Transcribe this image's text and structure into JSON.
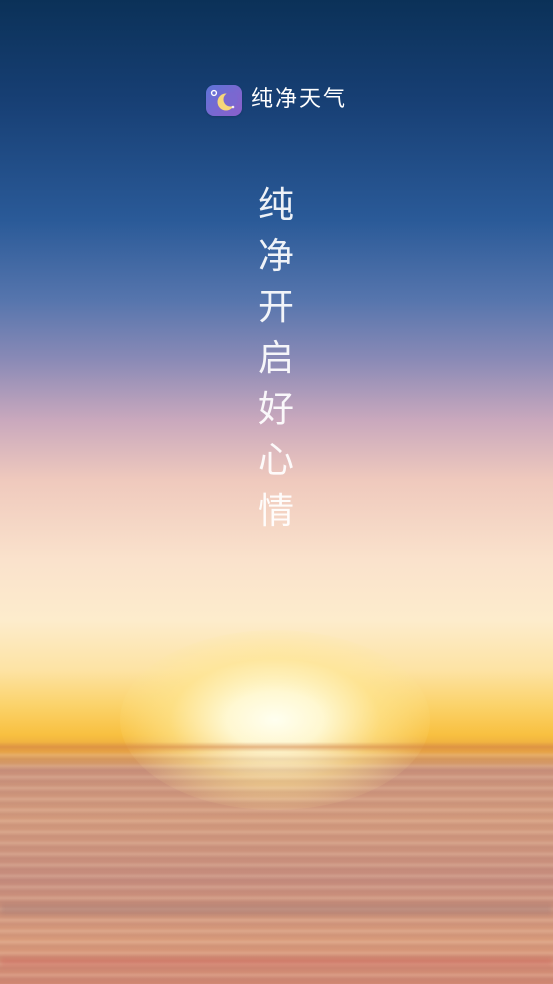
{
  "app": {
    "name": "纯净天气",
    "icon": "moon-thermometer-icon"
  },
  "slogan": {
    "chars": [
      "纯",
      "净",
      "开",
      "启",
      "好",
      "心",
      "情"
    ]
  },
  "colors": {
    "sky_top": "#0b3158",
    "sky_mid": "#8a8ab6",
    "sunset_glow": "#fbd36b",
    "water": "#c58b7c",
    "icon_gradient_start": "#5d74d8",
    "icon_gradient_end": "#8b5fca"
  }
}
